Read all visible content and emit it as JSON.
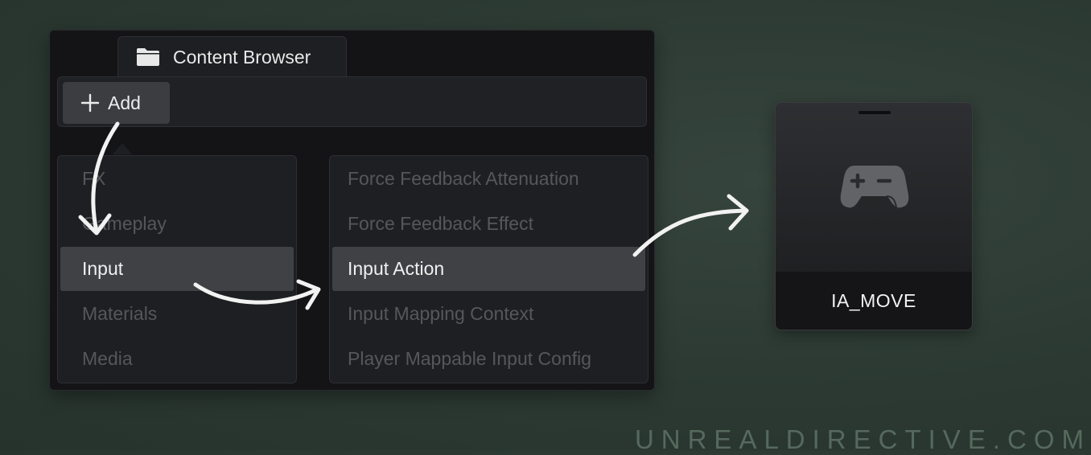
{
  "window": {
    "tab_title": "Content Browser",
    "tab_icon": "folder-icon",
    "add_button_label": "Add",
    "add_button_icon": "plus-icon"
  },
  "category_menu": {
    "items": [
      {
        "label": "FX",
        "selected": false
      },
      {
        "label": "Gameplay",
        "selected": false
      },
      {
        "label": "Input",
        "selected": true
      },
      {
        "label": "Materials",
        "selected": false
      },
      {
        "label": "Media",
        "selected": false
      }
    ]
  },
  "submenu": {
    "items": [
      {
        "label": "Force Feedback Attenuation",
        "selected": false
      },
      {
        "label": "Force Feedback Effect",
        "selected": false
      },
      {
        "label": "Input Action",
        "selected": true
      },
      {
        "label": "Input Mapping Context",
        "selected": false
      },
      {
        "label": "Player Mappable Input Config",
        "selected": false
      }
    ]
  },
  "asset": {
    "name": "IA_MOVE",
    "icon": "gamepad-icon"
  },
  "watermark": "UNREALDIRECTIVE.COM",
  "colors": {
    "background": "#2c3933",
    "window": "#141416",
    "menu": "#1e1f22",
    "selected": "#404145",
    "dim_text": "#55575c",
    "arrow": "#f2f2f2"
  }
}
